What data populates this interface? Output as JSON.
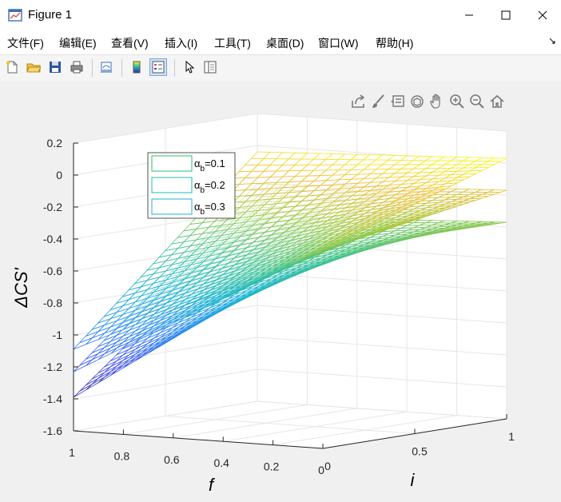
{
  "window": {
    "title": "Figure 1",
    "controls": [
      "minimize",
      "maximize",
      "close"
    ]
  },
  "menu": {
    "items": [
      "文件(F)",
      "编辑(E)",
      "查看(V)",
      "插入(I)",
      "工具(T)",
      "桌面(D)",
      "窗口(W)",
      "帮助(H)"
    ]
  },
  "toolbar": {
    "buttons": [
      "new-figure-icon",
      "open-file-icon",
      "save-icon",
      "print-icon",
      "link-plot-icon",
      "colorbar-icon",
      "legend-icon",
      "edit-plot-icon",
      "property-inspector-icon"
    ]
  },
  "axes_toolbar": {
    "buttons": [
      "export-icon",
      "brush-icon",
      "data-tips-icon",
      "rotate-3d-icon",
      "pan-icon",
      "zoom-in-icon",
      "zoom-out-icon",
      "home-icon"
    ]
  },
  "chart_data": {
    "type": "surface",
    "xlabel": "f",
    "ylabel": "i",
    "zlabel": "ΔCS'",
    "xticks": [
      "1",
      "0.8",
      "0.6",
      "0.4",
      "0.2",
      "0"
    ],
    "yticks": [
      "0",
      "0.5",
      "1"
    ],
    "zticks": [
      "0.2",
      "0",
      "-0.2",
      "-0.4",
      "-0.6",
      "-0.8",
      "-1",
      "-1.2",
      "-1.4",
      "-1.6"
    ],
    "xlim": [
      0,
      1
    ],
    "ylim": [
      0,
      1
    ],
    "zlim": [
      -1.6,
      0.2
    ],
    "grid": true,
    "colormap": "parula",
    "legend_position": "top-left",
    "series": [
      {
        "name": "α_b=0.1",
        "legend_base": "α",
        "legend_sub": "b",
        "legend_rest": "=0.1",
        "edge_color": "#2fbf6f",
        "corner_values": {
          "f1_i0": -1.09,
          "f1_i1": -0.04,
          "f0_i0": -0.36,
          "f0_i1": 0.03
        }
      },
      {
        "name": "α_b=0.2",
        "legend_base": "α",
        "legend_sub": "b",
        "legend_rest": "=0.2",
        "edge_color": "#1fbfa8",
        "corner_values": {
          "f1_i0": -1.23,
          "f1_i1": -0.24,
          "f0_i0": -0.36,
          "f0_i1": -0.17
        }
      },
      {
        "name": "α_b=0.3",
        "legend_base": "α",
        "legend_sub": "b",
        "legend_rest": "=0.3",
        "edge_color": "#1eb3d4",
        "corner_values": {
          "f1_i0": -1.39,
          "f1_i1": -0.44,
          "f0_i0": -0.36,
          "f0_i1": -0.37
        }
      }
    ]
  }
}
